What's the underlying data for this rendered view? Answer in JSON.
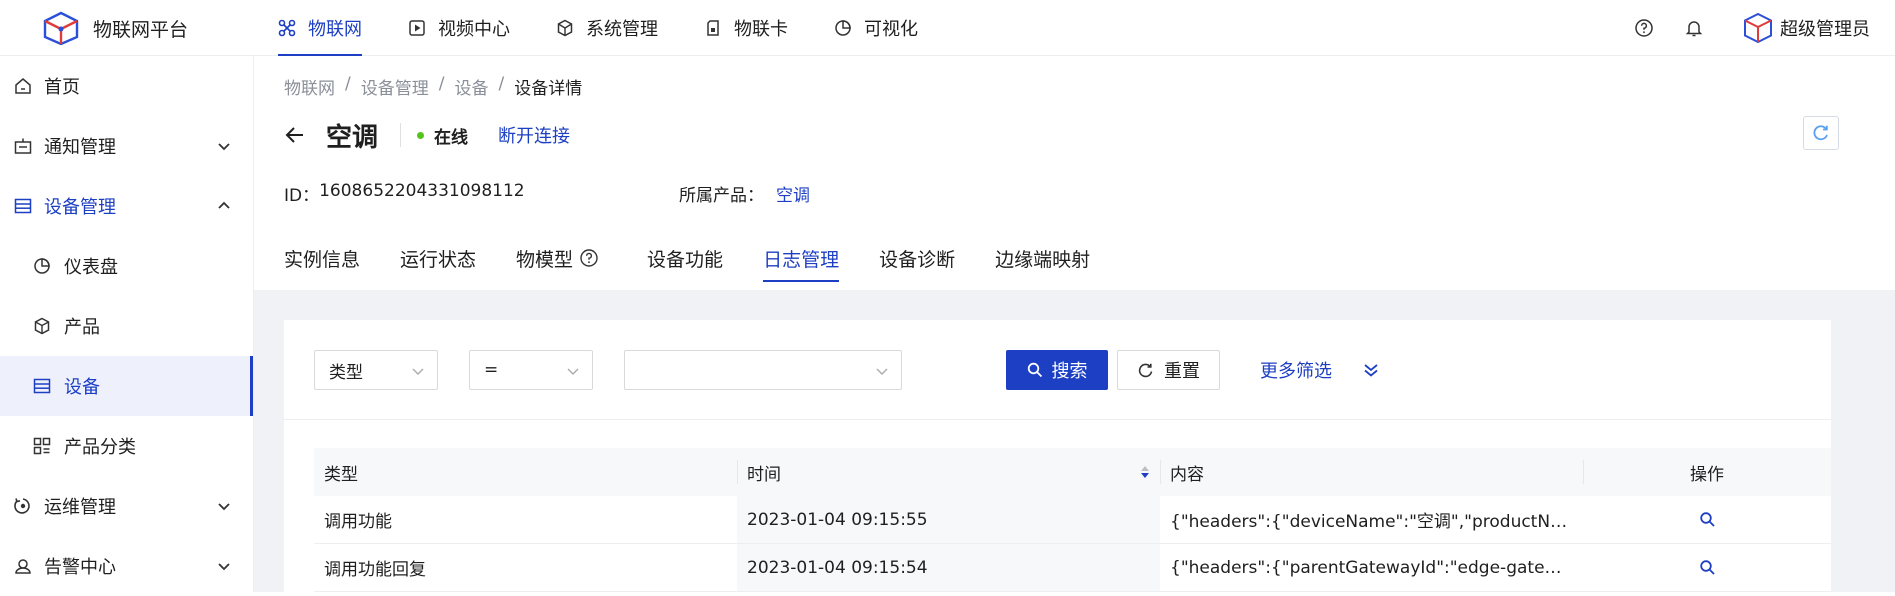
{
  "app": {
    "title": "物联网平台"
  },
  "topnav": [
    {
      "label": "物联网",
      "icon": "iot-icon",
      "active": true
    },
    {
      "label": "视频中心",
      "icon": "video-icon"
    },
    {
      "label": "系统管理",
      "icon": "system-icon"
    },
    {
      "label": "物联卡",
      "icon": "sim-card-icon"
    },
    {
      "label": "可视化",
      "icon": "pie-chart-icon"
    }
  ],
  "user": {
    "name": "超级管理员"
  },
  "sidebar": [
    {
      "label": "首页",
      "icon": "home-icon"
    },
    {
      "label": "通知管理",
      "icon": "notification-icon",
      "expandable": true
    },
    {
      "label": "设备管理",
      "icon": "device-management-icon",
      "expandable": true,
      "open": true
    },
    {
      "label": "仪表盘",
      "icon": "dashboard-icon",
      "sub": true
    },
    {
      "label": "产品",
      "icon": "product-icon",
      "sub": true
    },
    {
      "label": "设备",
      "icon": "device-icon",
      "sub": true,
      "selected": true
    },
    {
      "label": "产品分类",
      "icon": "category-icon",
      "sub": true
    },
    {
      "label": "运维管理",
      "icon": "ops-icon",
      "expandable": true
    },
    {
      "label": "告警中心",
      "icon": "alarm-icon",
      "expandable": true
    }
  ],
  "breadcrumb": [
    "物联网",
    "/",
    "设备管理",
    "/",
    "设备",
    "/",
    "设备详情"
  ],
  "device": {
    "name": "空调",
    "status": "在线",
    "status_color": "#52c41a",
    "disconnect_label": "断开连接",
    "id_label": "ID：",
    "id": "1608652204331098112",
    "product_label": "所属产品：",
    "product": "空调"
  },
  "tabs": [
    "实例信息",
    "运行状态",
    "物模型",
    "设备功能",
    "日志管理",
    "设备诊断",
    "边缘端映射"
  ],
  "active_tab": "日志管理",
  "filter": {
    "field": "类型",
    "operator": "=",
    "value": "",
    "search_label": "搜索",
    "reset_label": "重置",
    "more_label": "更多筛选"
  },
  "table": {
    "columns": [
      "类型",
      "时间",
      "内容",
      "操作"
    ],
    "rows": [
      {
        "type": "调用功能",
        "time": "2023-01-04 09:15:55",
        "content": "{\"headers\":{\"deviceName\":\"空调\",\"productNam\",\"p..."
      },
      {
        "type": "调用功能回复",
        "time": "2023-01-04 09:15:54",
        "content": "{\"headers\":{\"parentGatewayId\":\"edge-gateway-78\"..."
      }
    ]
  },
  "colors": {
    "accent": "#1d3fc4",
    "online": "#52c41a"
  }
}
